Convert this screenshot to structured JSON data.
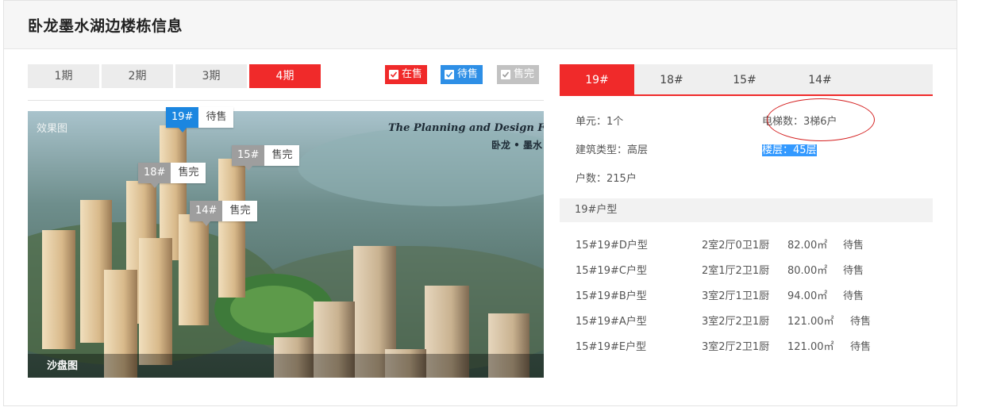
{
  "header": {
    "title": "卧龙墨水湖边楼栋信息"
  },
  "phases": [
    {
      "label": "1期",
      "active": false
    },
    {
      "label": "2期",
      "active": false
    },
    {
      "label": "3期",
      "active": false
    },
    {
      "label": "4期",
      "active": true
    }
  ],
  "legend": [
    {
      "label": "在售",
      "color": "#f02a2a",
      "checked": true
    },
    {
      "label": "待售",
      "color": "#2e8fe6",
      "checked": true
    },
    {
      "label": "售完",
      "color": "#c2c2c2",
      "checked": true
    }
  ],
  "image": {
    "overlay_label": "效果图",
    "caption": "沙盘图",
    "promo_line": "The Planning and Design For Wol",
    "promo_sub": "卧龙 • 墨水"
  },
  "building_tags": [
    {
      "num": "19#",
      "status": "待售",
      "color": "#1b86e0"
    },
    {
      "num": "15#",
      "status": "售完",
      "color": "#9e9e9e"
    },
    {
      "num": "18#",
      "status": "售完",
      "color": "#9e9e9e"
    },
    {
      "num": "14#",
      "status": "售完",
      "color": "#9e9e9e"
    }
  ],
  "building_tabs": [
    {
      "label": "19#",
      "active": true
    },
    {
      "label": "18#",
      "active": false
    },
    {
      "label": "15#",
      "active": false
    },
    {
      "label": "14#",
      "active": false
    }
  ],
  "info": {
    "units": "单元：1个",
    "elevator_label": "电梯数：",
    "elevator_value": "3梯6户",
    "building_type": "建筑类型：高层",
    "floors": "楼层：45层",
    "households": "户数：215户"
  },
  "unit_types": {
    "heading": "19#户型",
    "rows": [
      {
        "name": "15#19#D户型",
        "layout": "2室2厅0卫1厨",
        "area": "82.00㎡",
        "status": "待售"
      },
      {
        "name": "15#19#C户型",
        "layout": "2室1厅2卫1厨",
        "area": "80.00㎡",
        "status": "待售"
      },
      {
        "name": "15#19#B户型",
        "layout": "3室2厅1卫1厨",
        "area": "94.00㎡",
        "status": "待售"
      },
      {
        "name": "15#19#A户型",
        "layout": "3室2厅2卫1厨",
        "area": "121.00㎡",
        "status": "待售"
      },
      {
        "name": "15#19#E户型",
        "layout": "3室2厅2卫1厨",
        "area": "121.00㎡",
        "status": "待售"
      }
    ]
  },
  "colors": {
    "accent": "#f02a2a",
    "pending": "#1b86e0",
    "soldout": "#9e9e9e"
  }
}
